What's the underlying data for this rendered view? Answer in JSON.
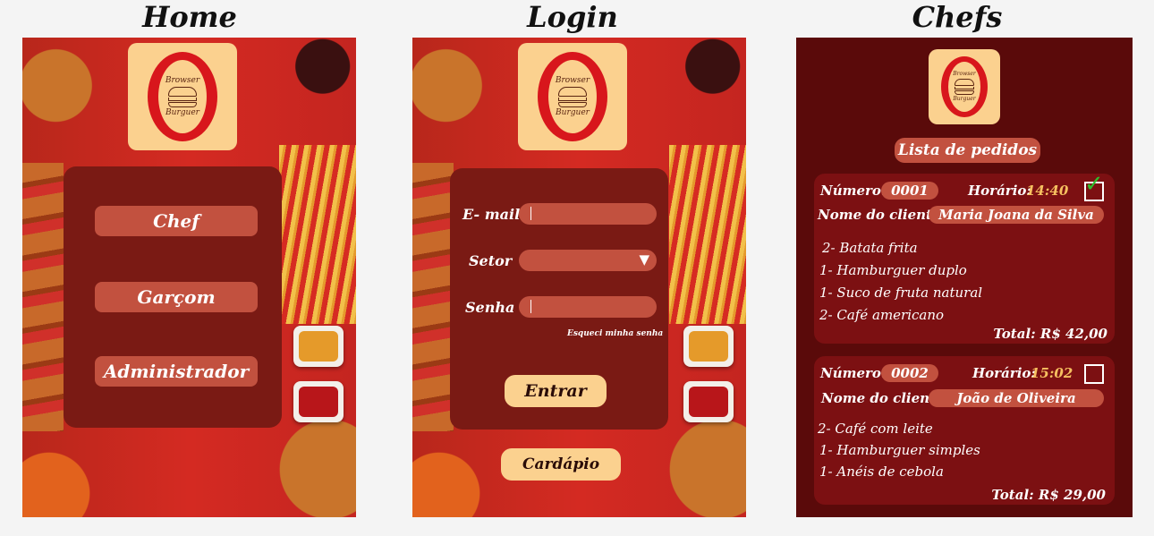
{
  "screens": {
    "home": {
      "title": "Home"
    },
    "login": {
      "title": "Login"
    },
    "chefs": {
      "title": "Chefs"
    }
  },
  "logo": {
    "line1": "Browser",
    "line2": "Burguer"
  },
  "home": {
    "buttons": [
      "Chef",
      "Garçom",
      "Administrador"
    ]
  },
  "login": {
    "email_label": "E- mail",
    "sector_label": "Setor",
    "password_label": "Senha",
    "sector_dropdown_icon": "▼",
    "forgot_password": "Esqueci minha senha",
    "submit_label": "Entrar",
    "menu_label": "Cardápio"
  },
  "chefs": {
    "list_title": "Lista de pedidos",
    "orders": [
      {
        "number_label": "Número:",
        "number": "0001",
        "time_label": "Horário:",
        "time": "14:40",
        "checked": true,
        "client_label": "Nome do cliente:",
        "client": "Maria Joana da Silva",
        "items": [
          "2- Batata frita",
          "1- Hamburguer duplo",
          "1- Suco de fruta natural",
          "2- Café americano"
        ],
        "total": "Total: R$ 42,00"
      },
      {
        "number_label": "Número:",
        "number": "0002",
        "time_label": "Horário:",
        "time": "15:02",
        "checked": false,
        "client_label": "Nome do cliente:",
        "client": "João de Oliveira",
        "items": [
          "2- Café com leite",
          "1- Hamburguer simples",
          "1- Anéis de cebola"
        ],
        "total": "Total: R$ 29,00"
      }
    ]
  },
  "colors": {
    "brand_red": "#d8161c",
    "panel": "#7a1a14",
    "cream": "#fbd18f",
    "button": "#c2513f",
    "time": "#f6c060",
    "check": "#2ec02e"
  }
}
